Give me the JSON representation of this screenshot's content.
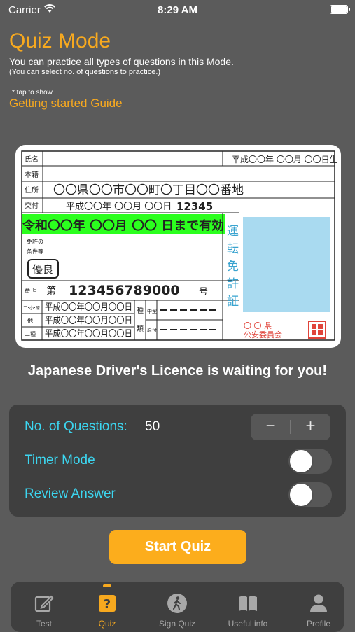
{
  "status_bar": {
    "carrier": "Carrier",
    "time": "8:29 AM"
  },
  "header": {
    "title": "Quiz Mode",
    "description": "You can practice all types of questions in this Mode.",
    "sub_description": "(You can select no. of questions to practice.)",
    "tap_note": "* tap to show",
    "guide_link": "Getting started Guide"
  },
  "licence_card": {
    "name_label": "氏名",
    "birth_date": "平成〇〇年 〇〇月 〇〇日生",
    "domicile_label": "本籍",
    "address_label": "住所",
    "address": "〇〇県〇〇市〇〇町〇丁目〇〇番地",
    "issue_label": "交付",
    "issue_date": "平成〇〇年 〇〇月 〇〇日",
    "issue_number": "12345",
    "expiry": "令和〇〇年 〇〇月 〇〇 日まで有効",
    "conditions_label_1": "免許の",
    "conditions_label_2": "条件等",
    "excellent_badge": "優良",
    "number_label": "番 号",
    "number_prefix": "第",
    "licence_number": "123456789000",
    "number_suffix": "号",
    "class_labels": [
      "二･小･原",
      "他",
      "二種"
    ],
    "class_dates": [
      "平成〇〇年〇〇月〇〇日",
      "平成〇〇年〇〇月〇〇日",
      "平成〇〇年〇〇月〇〇日"
    ],
    "type_label_1": "種",
    "type_label_2": "類",
    "type_mid": "中型",
    "type_orig": "原付",
    "vertical_title": [
      "運",
      "転",
      "免",
      "許",
      "証"
    ],
    "issuer_top": "〇 〇 県",
    "issuer": "公安委員会",
    "colors": {
      "expiry_bg": "#2bff1e",
      "photo_bg": "#a9daf0",
      "vertical_text": "#3aa4d0",
      "issuer": "#e0443a"
    }
  },
  "tagline": "Japanese Driver's Licence is waiting for you!",
  "settings": {
    "questions_label": "No. of Questions:",
    "questions_value": "50",
    "stepper_minus": "−",
    "stepper_plus": "+",
    "timer_label": "Timer Mode",
    "timer_on": false,
    "review_label": "Review Answer",
    "review_on": false
  },
  "start_button": "Start Quiz",
  "tabs": [
    {
      "label": "Test",
      "icon": "pencil-square-icon",
      "active": false
    },
    {
      "label": "Quiz",
      "icon": "question-square-icon",
      "active": true
    },
    {
      "label": "Sign Quiz",
      "icon": "walking-person-icon",
      "active": false
    },
    {
      "label": "Useful info",
      "icon": "book-icon",
      "active": false
    },
    {
      "label": "Profile",
      "icon": "person-icon",
      "active": false
    }
  ],
  "colors": {
    "accent": "#f7a91f",
    "link": "#3cd6f0",
    "background": "#5b5b5b",
    "panel": "#3f3f3f",
    "button": "#fcad1c"
  }
}
